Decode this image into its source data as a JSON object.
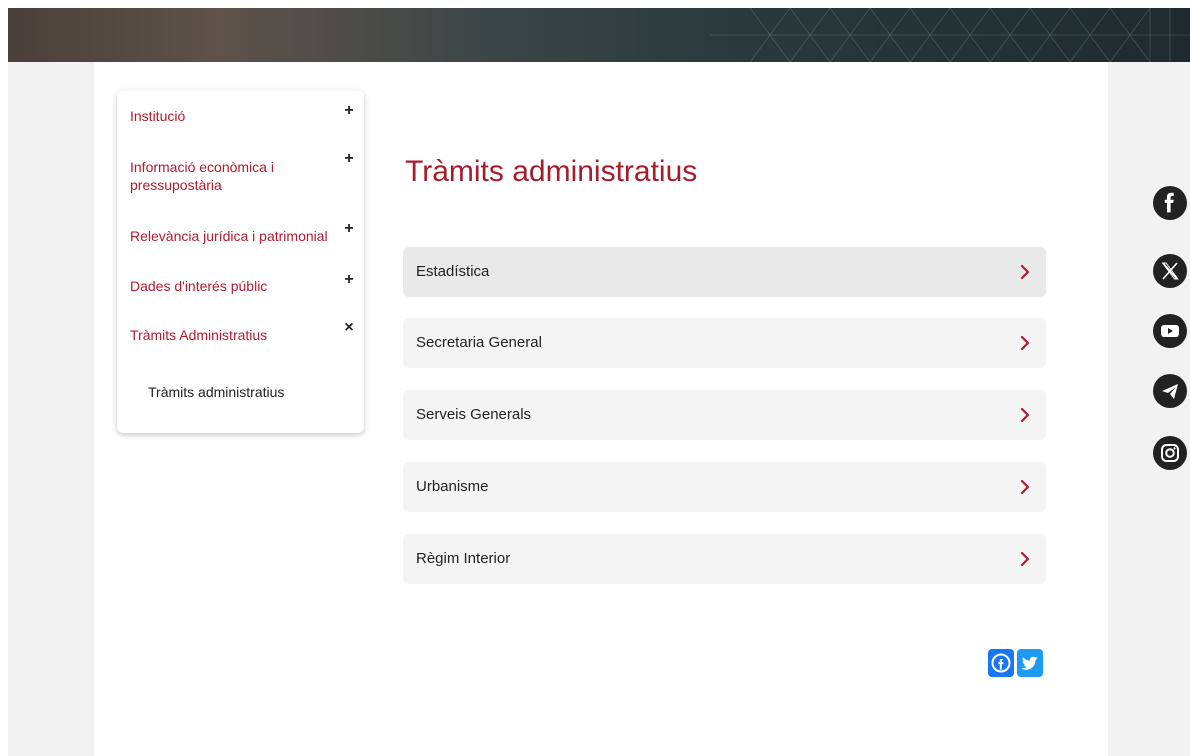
{
  "nav": {
    "items": [
      {
        "label": "Institució",
        "toggle": "+"
      },
      {
        "label": "Informació econòmica i pressupostària",
        "toggle": "+"
      },
      {
        "label": "Relevància jurídica i patrimonial",
        "toggle": "+"
      },
      {
        "label": "Dades d'interés públic",
        "toggle": "+"
      },
      {
        "label": "Tràmits Administratius",
        "toggle": "×"
      }
    ],
    "sub_item": "Tràmits administratius"
  },
  "main": {
    "title": "Tràmits administratius",
    "items": [
      {
        "label": "Estadística"
      },
      {
        "label": "Secretaria General"
      },
      {
        "label": "Serveis Generals"
      },
      {
        "label": "Urbanisme"
      },
      {
        "label": "Règim Interior"
      }
    ]
  },
  "share": {
    "icons": [
      "facebook-icon",
      "twitter-icon"
    ]
  },
  "social": {
    "icons": [
      "facebook-icon",
      "x-icon",
      "youtube-icon",
      "telegram-icon",
      "instagram-icon"
    ]
  },
  "colors": {
    "accent": "#a51d2d",
    "link": "#b01c2e",
    "chevron": "#b01c2e",
    "social_bg": "#222222"
  }
}
